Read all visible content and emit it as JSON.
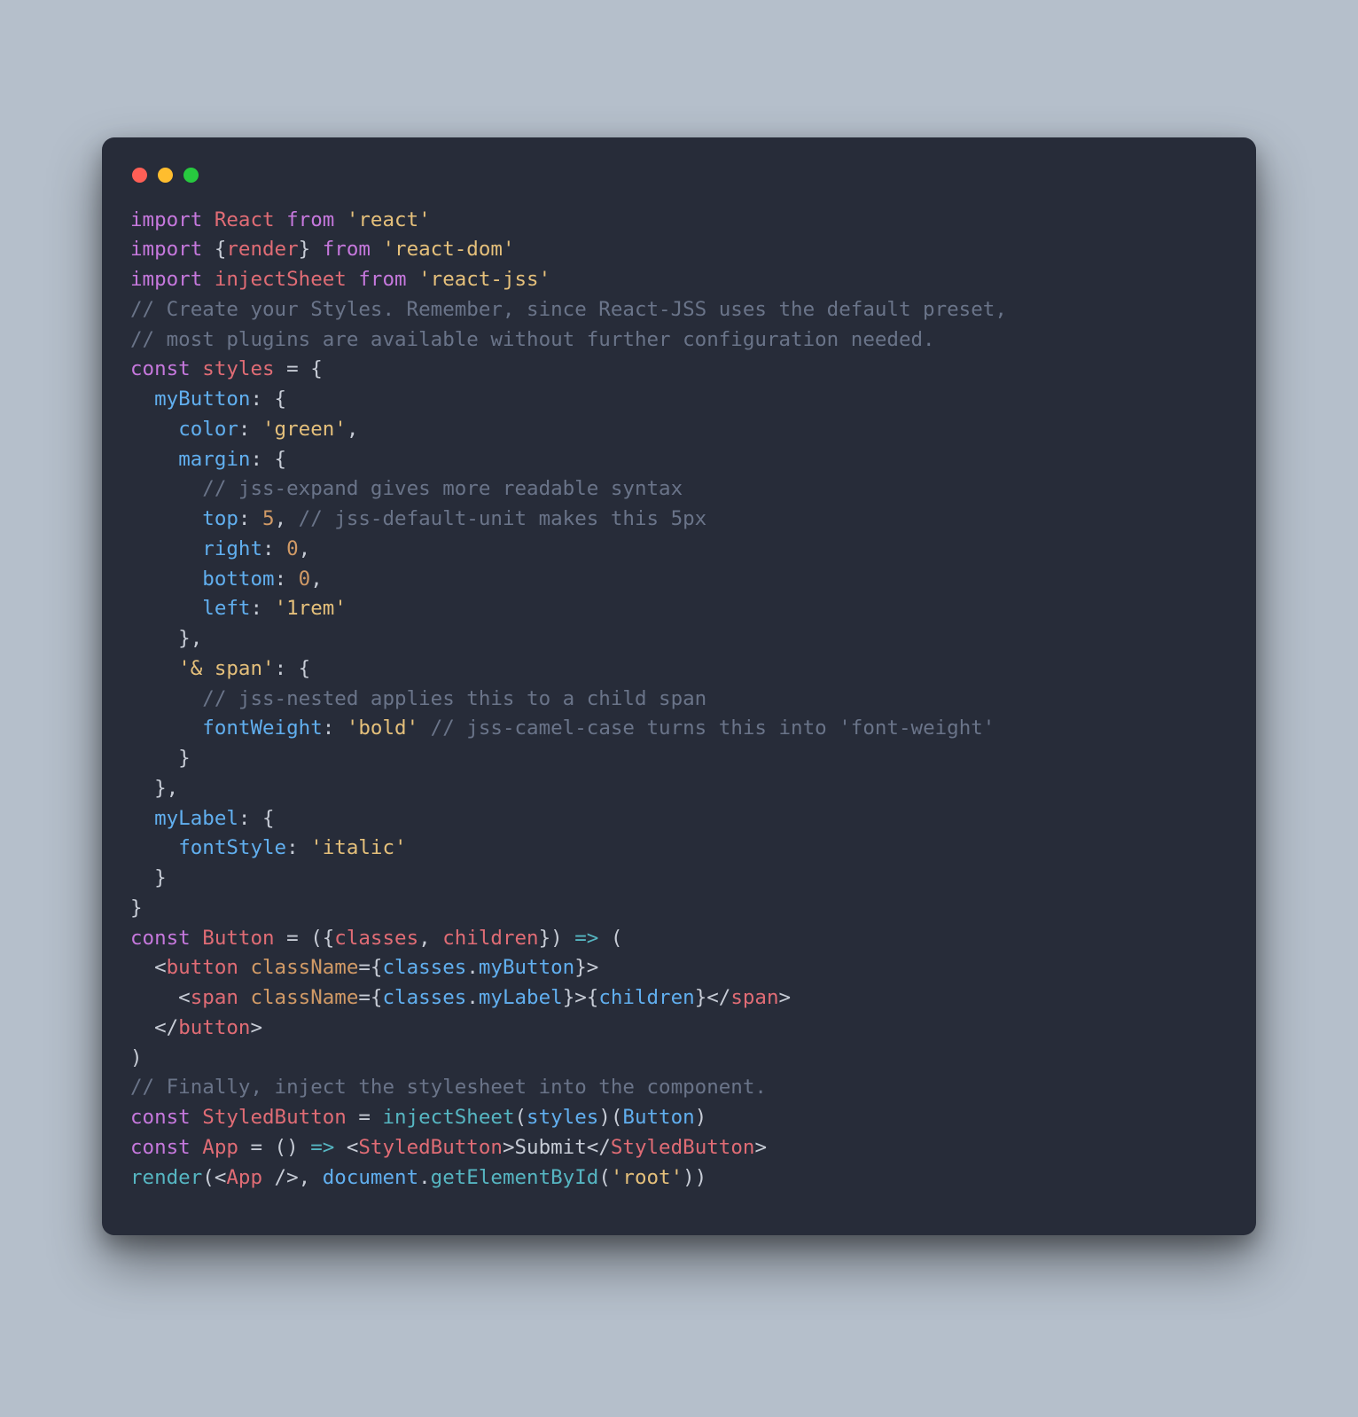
{
  "window": {
    "dots": [
      "red",
      "yellow",
      "green"
    ]
  },
  "colors": {
    "bg": "#b5bfcb",
    "editor_bg": "#272c39",
    "keyword": "#c678dd",
    "definition": "#e06c75",
    "variable": "#61afef",
    "function": "#56b6c2",
    "string": "#e5c07b",
    "number": "#d19a66",
    "comment": "#6a7489",
    "tag": "#e06c75",
    "attr": "#d19a66",
    "text": "#c7ccd6"
  },
  "code": {
    "language": "javascript",
    "raw": "import React from 'react'\nimport {render} from 'react-dom'\nimport injectSheet from 'react-jss'\n// Create your Styles. Remember, since React-JSS uses the default preset,\n// most plugins are available without further configuration needed.\nconst styles = {\n  myButton: {\n    color: 'green',\n    margin: {\n      // jss-expand gives more readable syntax\n      top: 5, // jss-default-unit makes this 5px\n      right: 0,\n      bottom: 0,\n      left: '1rem'\n    },\n    '& span': {\n      // jss-nested applies this to a child span\n      fontWeight: 'bold' // jss-camel-case turns this into 'font-weight'\n    }\n  },\n  myLabel: {\n    fontStyle: 'italic'\n  }\n}\nconst Button = ({classes, children}) => (\n  <button className={classes.myButton}>\n    <span className={classes.myLabel}>{children}</span>\n  </button>\n)\n// Finally, inject the stylesheet into the component.\nconst StyledButton = injectSheet(styles)(Button)\nconst App = () => <StyledButton>Submit</StyledButton>\nrender(<App />, document.getElementById('root'))",
    "tokens": [
      [
        [
          "kw",
          "import"
        ],
        [
          "punct",
          " "
        ],
        [
          "def",
          "React"
        ],
        [
          "punct",
          " "
        ],
        [
          "kw",
          "from"
        ],
        [
          "punct",
          " "
        ],
        [
          "str",
          "'react'"
        ]
      ],
      [
        [
          "kw",
          "import"
        ],
        [
          "punct",
          " {"
        ],
        [
          "def",
          "render"
        ],
        [
          "punct",
          "} "
        ],
        [
          "kw",
          "from"
        ],
        [
          "punct",
          " "
        ],
        [
          "str",
          "'react-dom'"
        ]
      ],
      [
        [
          "kw",
          "import"
        ],
        [
          "punct",
          " "
        ],
        [
          "def",
          "injectSheet"
        ],
        [
          "punct",
          " "
        ],
        [
          "kw",
          "from"
        ],
        [
          "punct",
          " "
        ],
        [
          "str",
          "'react-jss'"
        ]
      ],
      [
        [
          "cmt",
          "// Create your Styles. Remember, since React-JSS uses the default preset,"
        ]
      ],
      [
        [
          "cmt",
          "// most plugins are available without further configuration needed."
        ]
      ],
      [
        [
          "kw",
          "const"
        ],
        [
          "punct",
          " "
        ],
        [
          "def",
          "styles"
        ],
        [
          "punct",
          " = {"
        ]
      ],
      [
        [
          "punct",
          "  "
        ],
        [
          "var",
          "myButton"
        ],
        [
          "punct",
          ": {"
        ]
      ],
      [
        [
          "punct",
          "    "
        ],
        [
          "var",
          "color"
        ],
        [
          "punct",
          ": "
        ],
        [
          "str",
          "'green'"
        ],
        [
          "punct",
          ","
        ]
      ],
      [
        [
          "punct",
          "    "
        ],
        [
          "var",
          "margin"
        ],
        [
          "punct",
          ": {"
        ]
      ],
      [
        [
          "punct",
          "      "
        ],
        [
          "cmt",
          "// jss-expand gives more readable syntax"
        ]
      ],
      [
        [
          "punct",
          "      "
        ],
        [
          "var",
          "top"
        ],
        [
          "punct",
          ": "
        ],
        [
          "num",
          "5"
        ],
        [
          "punct",
          ", "
        ],
        [
          "cmt",
          "// jss-default-unit makes this 5px"
        ]
      ],
      [
        [
          "punct",
          "      "
        ],
        [
          "var",
          "right"
        ],
        [
          "punct",
          ": "
        ],
        [
          "num",
          "0"
        ],
        [
          "punct",
          ","
        ]
      ],
      [
        [
          "punct",
          "      "
        ],
        [
          "var",
          "bottom"
        ],
        [
          "punct",
          ": "
        ],
        [
          "num",
          "0"
        ],
        [
          "punct",
          ","
        ]
      ],
      [
        [
          "punct",
          "      "
        ],
        [
          "var",
          "left"
        ],
        [
          "punct",
          ": "
        ],
        [
          "str",
          "'1rem'"
        ]
      ],
      [
        [
          "punct",
          "    },"
        ]
      ],
      [
        [
          "punct",
          "    "
        ],
        [
          "str",
          "'& span'"
        ],
        [
          "punct",
          ": {"
        ]
      ],
      [
        [
          "punct",
          "      "
        ],
        [
          "cmt",
          "// jss-nested applies this to a child span"
        ]
      ],
      [
        [
          "punct",
          "      "
        ],
        [
          "var",
          "fontWeight"
        ],
        [
          "punct",
          ": "
        ],
        [
          "str",
          "'bold'"
        ],
        [
          "punct",
          " "
        ],
        [
          "cmt",
          "// jss-camel-case turns this into 'font-weight'"
        ]
      ],
      [
        [
          "punct",
          "    }"
        ]
      ],
      [
        [
          "punct",
          "  },"
        ]
      ],
      [
        [
          "punct",
          "  "
        ],
        [
          "var",
          "myLabel"
        ],
        [
          "punct",
          ": {"
        ]
      ],
      [
        [
          "punct",
          "    "
        ],
        [
          "var",
          "fontStyle"
        ],
        [
          "punct",
          ": "
        ],
        [
          "str",
          "'italic'"
        ]
      ],
      [
        [
          "punct",
          "  }"
        ]
      ],
      [
        [
          "punct",
          "}"
        ]
      ],
      [
        [
          "kw",
          "const"
        ],
        [
          "punct",
          " "
        ],
        [
          "def",
          "Button"
        ],
        [
          "punct",
          " = ({"
        ],
        [
          "def",
          "classes"
        ],
        [
          "punct",
          ", "
        ],
        [
          "def",
          "children"
        ],
        [
          "punct",
          "}) "
        ],
        [
          "fn",
          "=>"
        ],
        [
          "punct",
          " ("
        ]
      ],
      [
        [
          "punct",
          "  <"
        ],
        [
          "tag",
          "button"
        ],
        [
          "punct",
          " "
        ],
        [
          "attr",
          "className"
        ],
        [
          "punct",
          "={"
        ],
        [
          "var",
          "classes"
        ],
        [
          "punct",
          "."
        ],
        [
          "var",
          "myButton"
        ],
        [
          "punct",
          "}>"
        ]
      ],
      [
        [
          "punct",
          "    <"
        ],
        [
          "tag",
          "span"
        ],
        [
          "punct",
          " "
        ],
        [
          "attr",
          "className"
        ],
        [
          "punct",
          "={"
        ],
        [
          "var",
          "classes"
        ],
        [
          "punct",
          "."
        ],
        [
          "var",
          "myLabel"
        ],
        [
          "punct",
          "}>{"
        ],
        [
          "var",
          "children"
        ],
        [
          "punct",
          "}</"
        ],
        [
          "tag",
          "span"
        ],
        [
          "punct",
          ">"
        ]
      ],
      [
        [
          "punct",
          "  </"
        ],
        [
          "tag",
          "button"
        ],
        [
          "punct",
          ">"
        ]
      ],
      [
        [
          "punct",
          ")"
        ]
      ],
      [
        [
          "cmt",
          "// Finally, inject the stylesheet into the component."
        ]
      ],
      [
        [
          "kw",
          "const"
        ],
        [
          "punct",
          " "
        ],
        [
          "def",
          "StyledButton"
        ],
        [
          "punct",
          " = "
        ],
        [
          "fn",
          "injectSheet"
        ],
        [
          "punct",
          "("
        ],
        [
          "var",
          "styles"
        ],
        [
          "punct",
          ")("
        ],
        [
          "var",
          "Button"
        ],
        [
          "punct",
          ")"
        ]
      ],
      [
        [
          "kw",
          "const"
        ],
        [
          "punct",
          " "
        ],
        [
          "def",
          "App"
        ],
        [
          "punct",
          " = () "
        ],
        [
          "fn",
          "=>"
        ],
        [
          "punct",
          " <"
        ],
        [
          "tag",
          "StyledButton"
        ],
        [
          "punct",
          ">Submit</"
        ],
        [
          "tag",
          "StyledButton"
        ],
        [
          "punct",
          ">"
        ]
      ],
      [
        [
          "fn",
          "render"
        ],
        [
          "punct",
          "(<"
        ],
        [
          "tag",
          "App"
        ],
        [
          "punct",
          " />, "
        ],
        [
          "var",
          "document"
        ],
        [
          "punct",
          "."
        ],
        [
          "fn",
          "getElementById"
        ],
        [
          "punct",
          "("
        ],
        [
          "str",
          "'root'"
        ],
        [
          "punct",
          "))"
        ]
      ]
    ]
  }
}
